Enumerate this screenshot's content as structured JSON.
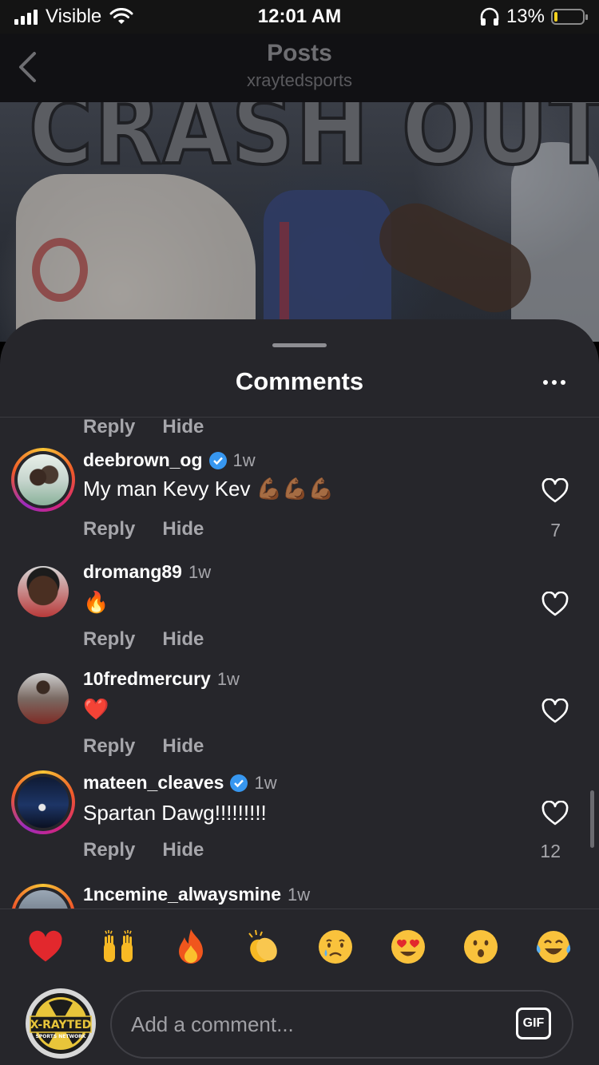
{
  "status_bar": {
    "carrier": "Visible",
    "time": "12:01 AM",
    "battery_percent_label": "13%",
    "battery_level": 0.13
  },
  "header": {
    "title": "Posts",
    "username": "xraytedsports"
  },
  "post": {
    "image_text": "CRASH OUT!"
  },
  "sheet": {
    "title": "Comments"
  },
  "actions": {
    "reply": "Reply",
    "hide": "Hide"
  },
  "comments": [
    {
      "username": "deebrown_og",
      "verified": true,
      "time": "1w",
      "text": "My man Kevy Kev 💪🏾💪🏾💪🏾",
      "likes": "7"
    },
    {
      "username": "dromang89",
      "verified": false,
      "time": "1w",
      "text": "🔥",
      "likes": ""
    },
    {
      "username": "10fredmercury",
      "verified": false,
      "time": "1w",
      "text": "❤️",
      "likes": ""
    },
    {
      "username": "mateen_cleaves",
      "verified": true,
      "time": "1w",
      "text": "Spartan Dawg!!!!!!!!!",
      "likes": "12"
    },
    {
      "username": "1ncemine_alwaysmine",
      "verified": false,
      "time": "1w",
      "text": "",
      "likes": ""
    }
  ],
  "reactions": [
    "❤️",
    "🙌",
    "🔥",
    "👏",
    "😢",
    "😍",
    "😮",
    "😂"
  ],
  "composer": {
    "placeholder": "Add a comment...",
    "gif_label": "GIF",
    "avatar_logo_text": "X-RAYTED",
    "avatar_logo_subtext": "SPORTS NETWORK"
  },
  "colors": {
    "sheet_bg": "#26262b",
    "verified": "#3797f0",
    "secondary_text": "#a6a6ab",
    "battery_fill": "#f4d11e"
  }
}
